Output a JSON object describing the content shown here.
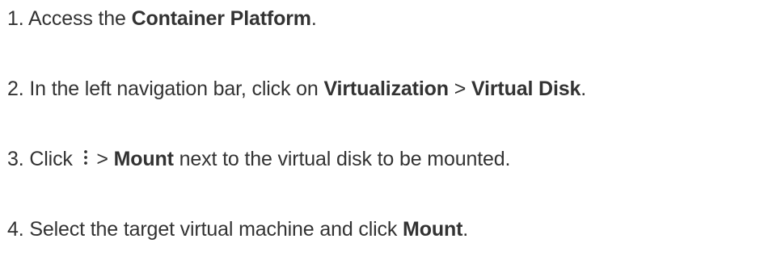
{
  "steps": [
    {
      "number": "1.",
      "parts": {
        "t1": "Access the ",
        "b1": "Container Platform",
        "t2": "."
      }
    },
    {
      "number": "2.",
      "parts": {
        "t1": "In the left navigation bar, click on ",
        "b1": "Virtualization",
        "t2": " > ",
        "b2": "Virtual Disk",
        "t3": "."
      }
    },
    {
      "number": "3.",
      "parts": {
        "t1": "Click ",
        "icon": "more-vertical-icon",
        "t2": " > ",
        "b1": "Mount",
        "t3": " next to the virtual disk to be mounted."
      }
    },
    {
      "number": "4.",
      "parts": {
        "t1": "Select the target virtual machine and click ",
        "b1": "Mount",
        "t2": "."
      }
    }
  ]
}
